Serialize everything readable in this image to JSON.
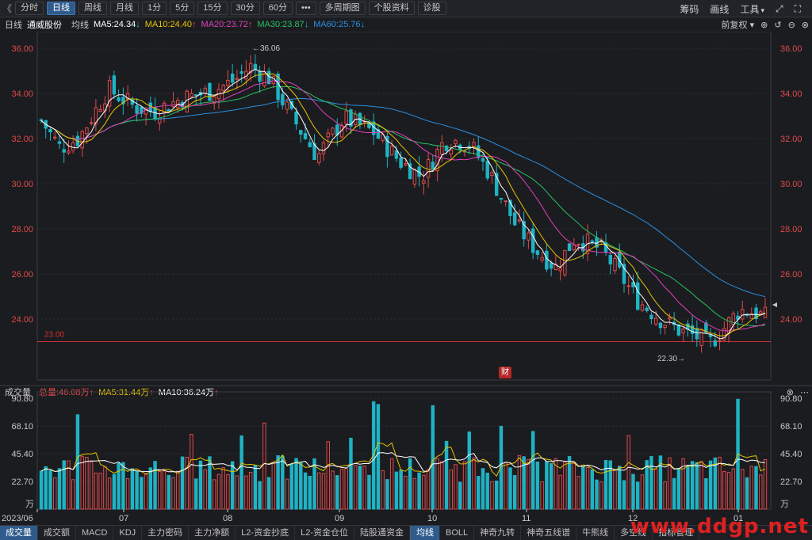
{
  "toolbar": {
    "items": [
      "分时",
      "日线",
      "周线",
      "月线",
      "1分",
      "5分",
      "15分",
      "30分",
      "60分",
      "•••",
      "多周期图",
      "个股资料",
      "诊股"
    ],
    "active_index": 1,
    "right_items": [
      "筹码",
      "画线",
      "工具"
    ]
  },
  "info": {
    "period": "日线",
    "stock_name": "通威股份",
    "ma_type": "均线",
    "ma5": "MA5:24.34",
    "ma10": "MA10:24.40",
    "ma20": "MA20:23.72",
    "ma30": "MA30:23.87",
    "ma60": "MA60:25.76",
    "adjust": "前复权"
  },
  "volume_info": {
    "title": "成交量",
    "total": "总量:46.08万",
    "ma5": "MA5:31.44万",
    "ma10": "MA10:36.24万"
  },
  "colors": {
    "up": "#e0494a",
    "down": "#1fb3c4",
    "ma5": "#ffffff",
    "ma10": "#e8c400",
    "ma20": "#e040b8",
    "ma30": "#28c060",
    "ma60": "#2a8fe0",
    "support": "#d03030"
  },
  "chart_data": {
    "type": "candlestick",
    "y_ticks": [
      "36.00",
      "34.00",
      "32.00",
      "30.00",
      "28.00",
      "26.00",
      "24.00"
    ],
    "ylim": [
      22.0,
      36.0
    ],
    "x_ticks": [
      "2023/06",
      "07",
      "08",
      "09",
      "10",
      "11",
      "12",
      "01"
    ],
    "high_label": "36.06",
    "low_label": "22.30",
    "support_label": "23.00",
    "support_value": 23.0,
    "volume_y_ticks": [
      "90.80",
      "68.10",
      "45.40",
      "22.70"
    ],
    "volume_unit": "万",
    "volume_ylim": [
      0,
      90.8
    ],
    "cai_label": "财"
  },
  "bottom_tabs": [
    "成交量",
    "成交额",
    "MACD",
    "KDJ",
    "主力密码",
    "主力净额",
    "L2-资金抄底",
    "L2-资金仓位",
    "陆股通资金",
    "均线",
    "BOLL",
    "神奇九转",
    "神奇五线谱",
    "牛熊线",
    "多空线",
    "指标管理"
  ],
  "bottom_active": [
    0,
    9
  ],
  "watermark": "www.ddgp.net"
}
